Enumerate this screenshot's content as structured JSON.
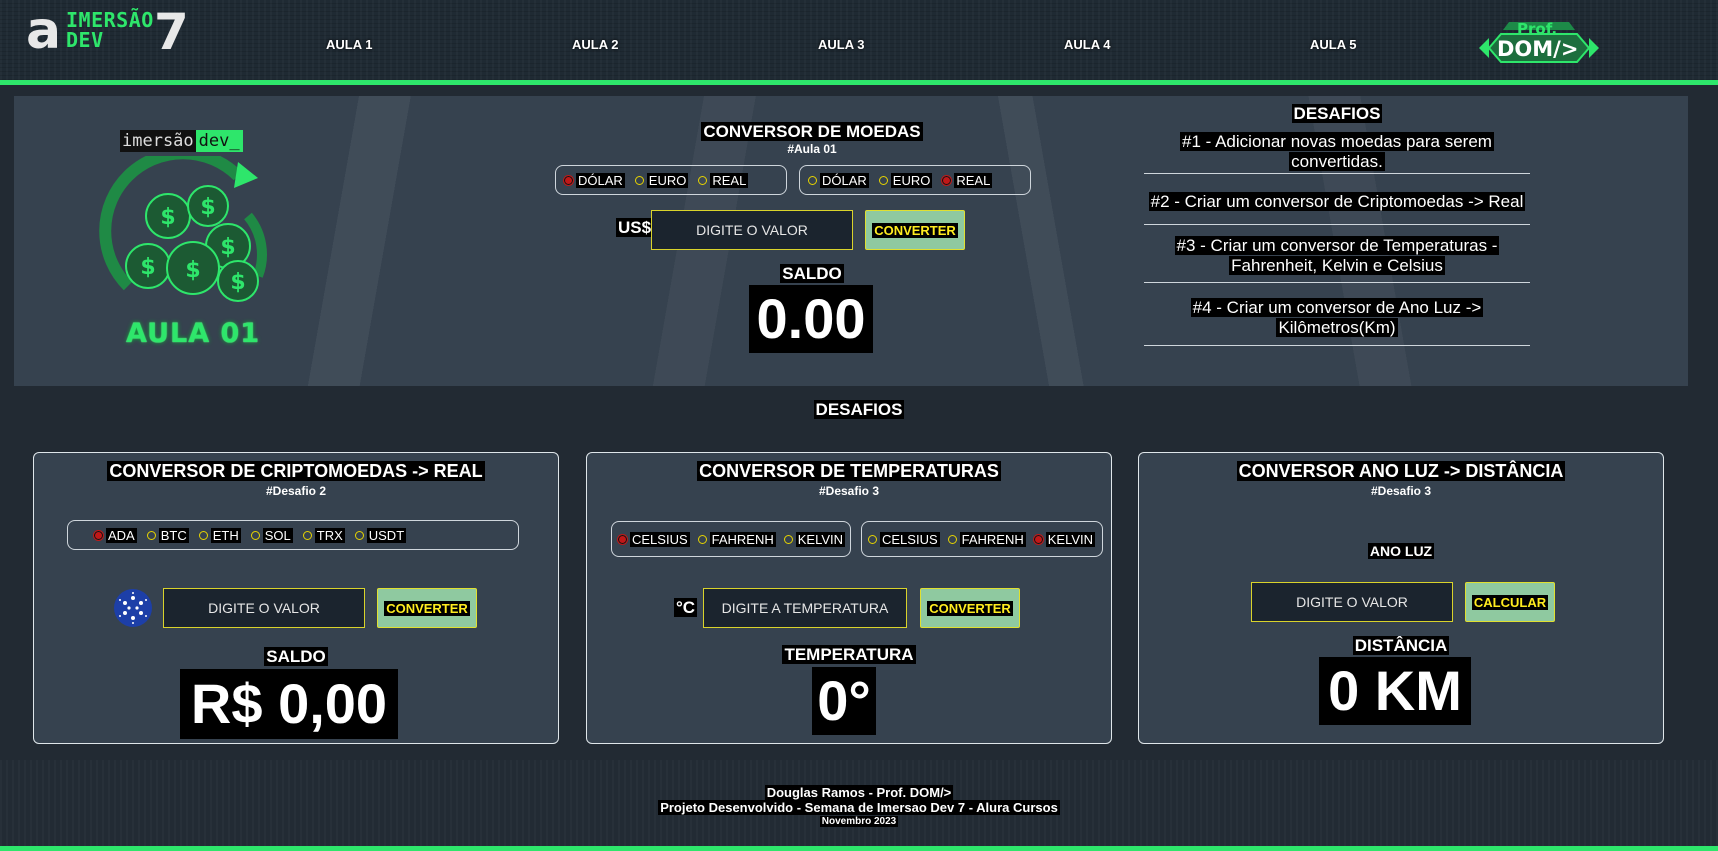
{
  "header": {
    "logo_mark": "a",
    "logo_line1": "IMERSÃO",
    "logo_line2": "DEV",
    "logo_number": "7",
    "nav": [
      "AULA 1",
      "AULA 2",
      "AULA 3",
      "AULA 4",
      "AULA 5"
    ],
    "prof_badge_top": "Prof.",
    "prof_badge_main": "DOM/>",
    "accent_color": "#2ee66b"
  },
  "hero": {
    "tag_left": "imersão",
    "tag_right": "dev_",
    "badge": "AULA 01",
    "converter": {
      "title": "CONVERSOR DE MOEDAS",
      "subtitle": "#Aula 01",
      "from_options": [
        {
          "label": "DÓLAR",
          "checked": true
        },
        {
          "label": "EURO",
          "checked": false
        },
        {
          "label": "REAL",
          "checked": false
        }
      ],
      "to_options": [
        {
          "label": "DÓLAR",
          "checked": false
        },
        {
          "label": "EURO",
          "checked": false
        },
        {
          "label": "REAL",
          "checked": true
        }
      ],
      "currency_symbol": "US$",
      "input_placeholder": "DIGITE O VALOR",
      "button": "CONVERTER",
      "result_label": "SALDO",
      "result_value": "0.00"
    },
    "challenges": {
      "title": "DESAFIOS",
      "items": [
        "#1 - Adicionar novas moedas para serem convertidas.",
        "#2 - Criar um conversor de Criptomoedas -> Real",
        "#3 - Criar um conversor de Temperaturas - Fahrenheit, Kelvin e Celsius",
        "#4 - Criar um conversor de Ano Luz -> Kilômetros(Km)"
      ]
    }
  },
  "desafios": {
    "title": "DESAFIOS",
    "crypto": {
      "title": "CONVERSOR DE CRIPTOMOEDAS -> REAL",
      "subtitle": "#Desafio 2",
      "options": [
        {
          "label": "ADA",
          "checked": true
        },
        {
          "label": "BTC",
          "checked": false
        },
        {
          "label": "ETH",
          "checked": false
        },
        {
          "label": "SOL",
          "checked": false
        },
        {
          "label": "TRX",
          "checked": false
        },
        {
          "label": "USDT",
          "checked": false
        }
      ],
      "coin_icon": "cardano-icon",
      "input_placeholder": "DIGITE O VALOR",
      "button": "CONVERTER",
      "result_label": "SALDO",
      "result_value": "R$ 0,00"
    },
    "temperature": {
      "title": "CONVERSOR DE TEMPERATURAS",
      "subtitle": "#Desafio 3",
      "from_options": [
        {
          "label": "CELSIUS",
          "checked": true
        },
        {
          "label": "FAHRENH",
          "checked": false
        },
        {
          "label": "KELVIN",
          "checked": false
        }
      ],
      "to_options": [
        {
          "label": "CELSIUS",
          "checked": false
        },
        {
          "label": "FAHRENH",
          "checked": false
        },
        {
          "label": "KELVIN",
          "checked": true
        }
      ],
      "unit_symbol": "°C",
      "input_placeholder": "DIGITE A TEMPERATURA",
      "button": "CONVERTER",
      "result_label": "TEMPERATURA",
      "result_value": "0°"
    },
    "lightyear": {
      "title": "CONVERSOR ANO LUZ -> DISTÂNCIA",
      "subtitle": "#Desafio 3",
      "input_label": "ANO LUZ",
      "input_placeholder": "DIGITE O VALOR",
      "button": "CALCULAR",
      "result_label": "DISTÂNCIA",
      "result_value": "0 KM"
    }
  },
  "footer": {
    "line1": "Douglas Ramos - Prof. DOM/>",
    "line2": "Projeto Desenvolvido - Semana de Imersao Dev 7 - Alura Cursos",
    "line3": "Novembro 2023"
  }
}
